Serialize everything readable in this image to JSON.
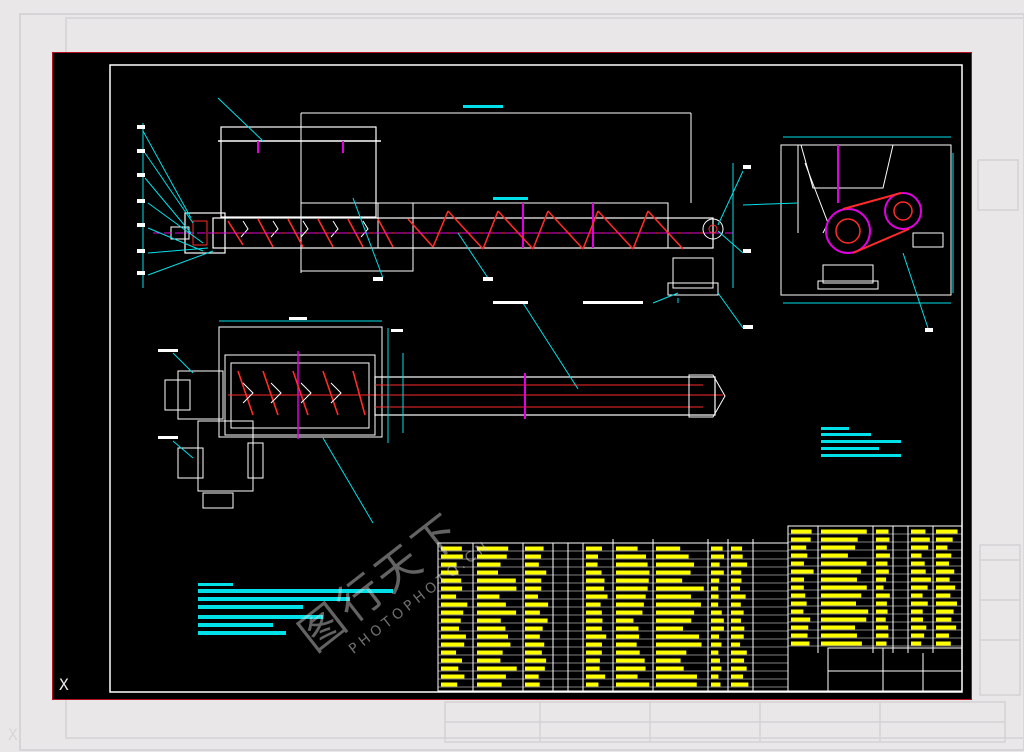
{
  "drawing": {
    "ucs_icon_label": "X",
    "colors": {
      "background": "#000000",
      "frame": "#ffffff",
      "sheet_border": "#b01020",
      "red": "#ff2a2a",
      "magenta": "#e000e0",
      "cyan": "#00e0e8",
      "yellow": "#ffff00",
      "white": "#ffffff"
    }
  },
  "watermark": {
    "cn": "图行天下",
    "en": "PHOTOPHOTO.CN"
  }
}
